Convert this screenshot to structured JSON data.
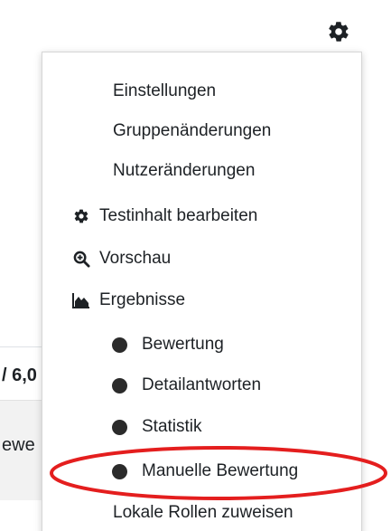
{
  "background": {
    "score_fragment": "/ 6,0",
    "row_fragment": "ewe"
  },
  "menu": {
    "items": [
      {
        "label": "Einstellungen"
      },
      {
        "label": "Gruppenänderungen"
      },
      {
        "label": "Nutzeränderungen"
      },
      {
        "label": "Testinhalt bearbeiten",
        "icon": "gear-icon"
      },
      {
        "label": "Vorschau",
        "icon": "zoom-in-icon"
      },
      {
        "label": "Ergebnisse",
        "icon": "area-chart-icon"
      },
      {
        "label": "Bewertung",
        "icon": "bullet-icon"
      },
      {
        "label": "Detailantworten",
        "icon": "bullet-icon"
      },
      {
        "label": "Statistik",
        "icon": "bullet-icon"
      },
      {
        "label": "Manuelle Bewertung",
        "icon": "bullet-icon"
      },
      {
        "label": "Lokale Rollen zuweisen"
      }
    ]
  },
  "colors": {
    "highlight": "#e41e1e",
    "text": "#1d2125"
  }
}
